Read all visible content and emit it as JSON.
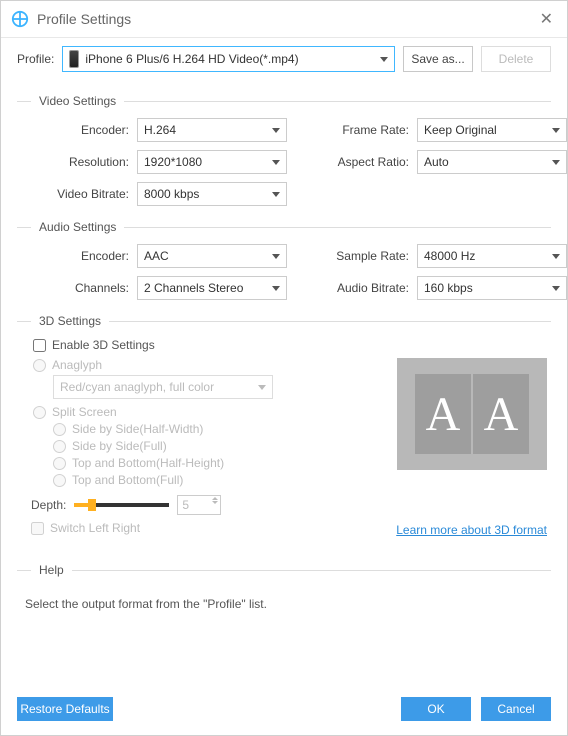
{
  "window": {
    "title": "Profile Settings"
  },
  "profile": {
    "label": "Profile:",
    "selected": "iPhone 6 Plus/6 H.264 HD Video(*.mp4)",
    "save_as": "Save as...",
    "delete": "Delete"
  },
  "video": {
    "heading": "Video Settings",
    "encoder_label": "Encoder:",
    "encoder": "H.264",
    "resolution_label": "Resolution:",
    "resolution": "1920*1080",
    "bitrate_label": "Video Bitrate:",
    "bitrate": "8000 kbps",
    "framerate_label": "Frame Rate:",
    "framerate": "Keep Original",
    "aspect_label": "Aspect Ratio:",
    "aspect": "Auto"
  },
  "audio": {
    "heading": "Audio Settings",
    "encoder_label": "Encoder:",
    "encoder": "AAC",
    "channels_label": "Channels:",
    "channels": "2 Channels Stereo",
    "samplerate_label": "Sample Rate:",
    "samplerate": "48000 Hz",
    "bitrate_label": "Audio Bitrate:",
    "bitrate": "160 kbps"
  },
  "three_d": {
    "heading": "3D Settings",
    "enable": "Enable 3D Settings",
    "anaglyph": "Anaglyph",
    "anaglyph_mode": "Red/cyan anaglyph, full color",
    "split": "Split Screen",
    "sbs_half": "Side by Side(Half-Width)",
    "sbs_full": "Side by Side(Full)",
    "tb_half": "Top and Bottom(Half-Height)",
    "tb_full": "Top and Bottom(Full)",
    "depth_label": "Depth:",
    "depth_value": "5",
    "switch_lr": "Switch Left Right",
    "learn_more": "Learn more about 3D format",
    "preview_glyph": "A"
  },
  "help": {
    "heading": "Help",
    "text": "Select the output format from the \"Profile\" list."
  },
  "footer": {
    "restore": "Restore Defaults",
    "ok": "OK",
    "cancel": "Cancel"
  }
}
